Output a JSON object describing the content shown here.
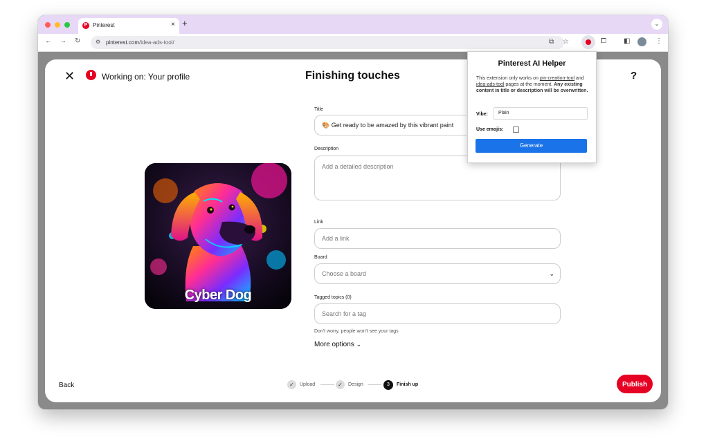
{
  "browser": {
    "tab_title": "Pinterest",
    "tab_close": "×",
    "new_tab": "+",
    "tab_dropdown": "⌄",
    "url_host": "pinterest.com",
    "url_path": "/idea-ads-tool/",
    "nav_back": "←",
    "nav_forward": "→",
    "nav_reload": "↻"
  },
  "page": {
    "close_icon": "✕",
    "working_on": "Working on: Your profile",
    "heading": "Finishing touches",
    "help": "?"
  },
  "pin": {
    "caption": "Cyber Dog"
  },
  "form": {
    "title_label": "Title",
    "title_value": "🎨 Get ready to be amazed by this vibrant paint",
    "description_label": "Description",
    "description_placeholder": "Add a detailed description",
    "link_label": "Link",
    "link_placeholder": "Add a link",
    "board_label": "Board",
    "board_placeholder": "Choose a board",
    "tags_label": "Tagged topics (0)",
    "tags_placeholder": "Search for a tag",
    "tags_hint": "Don't worry, people won't see your tags",
    "more_options": "More options"
  },
  "footer": {
    "back": "Back",
    "steps": [
      {
        "label": "Upload",
        "state": "done"
      },
      {
        "label": "Design",
        "state": "done"
      },
      {
        "label": "Finish up",
        "state": "current",
        "number": "3"
      }
    ],
    "publish": "Publish"
  },
  "extension_popup": {
    "title": "Pinterest AI Helper",
    "desc_1": "This extension only works on ",
    "link_1": "pin-creation-tool",
    "desc_2": " and ",
    "link_2": "idea-ads-tool",
    "desc_3": " pages at the moment. ",
    "desc_bold": "Any existing content in title or description will be overwritten.",
    "vibe_label": "Vibe:",
    "vibe_value": "Plain",
    "emojis_label": "Use emojis:",
    "emojis_checked": false,
    "generate": "Generate"
  },
  "colors": {
    "pinterest_red": "#e60023",
    "generate_blue": "#1a73e8",
    "tabbar": "#e7d8f6"
  }
}
